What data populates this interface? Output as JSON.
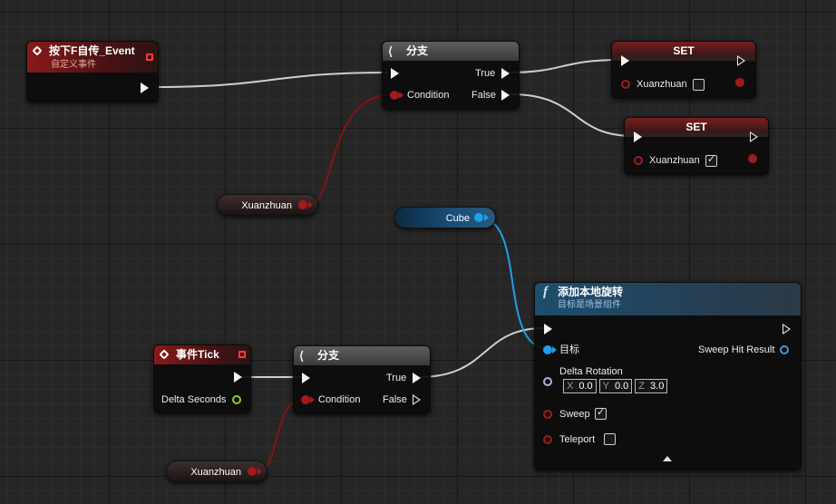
{
  "nodes": {
    "event_f": {
      "title": "按下F自传_Event",
      "subtitle": "自定义事件"
    },
    "branch_top": {
      "title": "分支",
      "in_label": "Condition",
      "true_label": "True",
      "false_label": "False"
    },
    "set1": {
      "title": "SET",
      "var_label": "Xuanzhuan",
      "checked": false
    },
    "set2": {
      "title": "SET",
      "var_label": "Xuanzhuan",
      "checked": true
    },
    "var_xuan_top": {
      "label": "Xuanzhuan"
    },
    "var_cube": {
      "label": "Cube"
    },
    "add_rot": {
      "title": "添加本地旋转",
      "subtitle": "目标是场景组件",
      "target_label": "目标",
      "sweep_hit_label": "Sweep Hit Result",
      "delta_rotation_label": "Delta Rotation",
      "x_label": "X",
      "x_value": "0.0",
      "y_label": "Y",
      "y_value": "0.0",
      "z_label": "Z",
      "z_value": "3.0",
      "sweep_label": "Sweep",
      "sweep_checked": true,
      "teleport_label": "Teleport",
      "teleport_checked": false
    },
    "event_tick": {
      "title": "事件Tick",
      "delta_label": "Delta Seconds"
    },
    "branch_bottom": {
      "title": "分支",
      "in_label": "Condition",
      "true_label": "True",
      "false_label": "False"
    },
    "var_xuan_bottom": {
      "label": "Xuanzhuan"
    }
  },
  "colors": {
    "exec": "#f2f2f2",
    "bool": "#a31a1a",
    "object": "#1fa0e8",
    "float": "#8ccc2a"
  }
}
